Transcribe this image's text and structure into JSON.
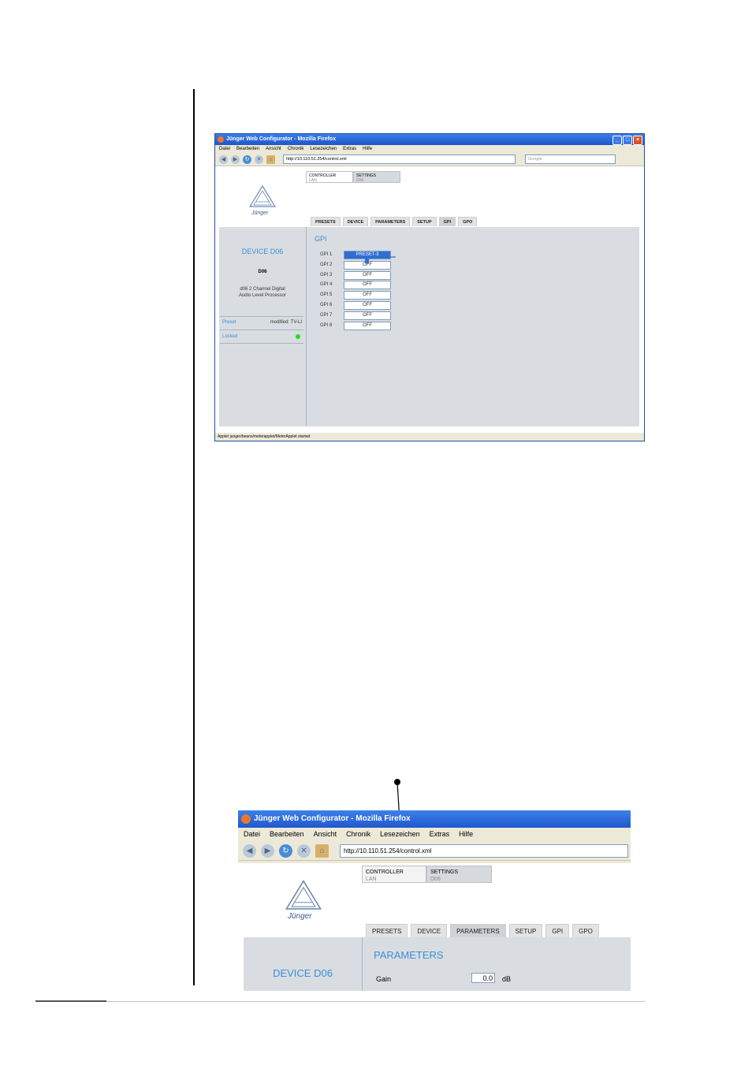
{
  "shot1": {
    "window_title": "Jünger Web Configurator - Mozilla Firefox",
    "menu": [
      "Datei",
      "Bearbeiten",
      "Ansicht",
      "Chronik",
      "Lesezeichen",
      "Extras",
      "Hilfe"
    ],
    "url": "http://10.110.51.254/control.xml",
    "search_placeholder": "Google",
    "header_tabs": [
      {
        "title": "CONTROLLER",
        "sub": "LAN"
      },
      {
        "title": "SETTINGS",
        "sub": "D06"
      }
    ],
    "logo_text": "Jünger",
    "tabs": [
      "PRESETS",
      "DEVICE",
      "PARAMETERS",
      "SETUP",
      "GPI",
      "GPO"
    ],
    "active_tab": "GPI",
    "sidebar": {
      "device_title": "DEVICE D06",
      "device_name": "D06",
      "description_line1": "d06 2 Channel Digital",
      "description_line2": "Audio Level Processor",
      "preset_label": "Preset",
      "preset_value": "modified: TV-LI",
      "locked_label": "Locked",
      "locked_color": "#22dd22"
    },
    "section_title": "GPI",
    "gpi": [
      {
        "label": "GPI 1",
        "value": "PRESET-3"
      },
      {
        "label": "GPI 2",
        "value": "OFF"
      },
      {
        "label": "GPI 3",
        "value": "OFF"
      },
      {
        "label": "GPI 4",
        "value": "OFF"
      },
      {
        "label": "GPI 5",
        "value": "OFF"
      },
      {
        "label": "GPI 6",
        "value": "OFF"
      },
      {
        "label": "GPI 7",
        "value": "OFF"
      },
      {
        "label": "GPI 8",
        "value": "OFF"
      }
    ],
    "status_bar": "Applet junger/beans/meterapplet/MeterApplet started"
  },
  "shot2": {
    "window_title": "Jünger Web Configurator - Mozilla Firefox",
    "menu": [
      "Datei",
      "Bearbeiten",
      "Ansicht",
      "Chronik",
      "Lesezeichen",
      "Extras",
      "Hilfe"
    ],
    "url": "http://10.110.51.254/control.xml",
    "header_tabs": [
      {
        "title": "CONTROLLER",
        "sub": "LAN"
      },
      {
        "title": "SETTINGS",
        "sub": "D06"
      }
    ],
    "logo_text": "Jünger",
    "tabs": [
      "PRESETS",
      "DEVICE",
      "PARAMETERS",
      "SETUP",
      "GPI",
      "GPO"
    ],
    "active_tab": "PARAMETERS",
    "device_title": "DEVICE D06",
    "section_title": "PARAMETERS",
    "gain_label": "Gain",
    "gain_value": "0.0",
    "gain_unit": "dB"
  }
}
